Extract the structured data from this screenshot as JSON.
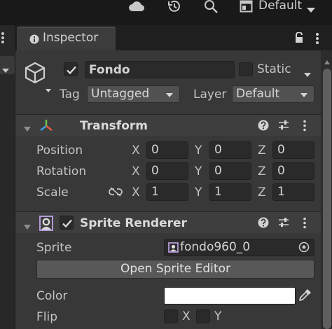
{
  "toolbar": {
    "icons": [
      "cloud-icon",
      "history-icon",
      "search-icon",
      "layout-icon"
    ],
    "layout_label": "Default"
  },
  "tab": {
    "title": "Inspector"
  },
  "object": {
    "active": true,
    "name": "Fondo",
    "static_label": "Static",
    "static_checked": false,
    "tag_label": "Tag",
    "tag_value": "Untagged",
    "layer_label": "Layer",
    "layer_value": "Default"
  },
  "transform": {
    "title": "Transform",
    "rows": [
      {
        "label": "Position",
        "x": "0",
        "y": "0",
        "z": "0"
      },
      {
        "label": "Rotation",
        "x": "0",
        "y": "0",
        "z": "0"
      },
      {
        "label": "Scale",
        "x": "1",
        "y": "1",
        "z": "1"
      }
    ],
    "axes": {
      "x": "X",
      "y": "Y",
      "z": "Z"
    }
  },
  "sprite_renderer": {
    "title": "Sprite Renderer",
    "enabled": true,
    "sprite_label": "Sprite",
    "sprite_value": "fondo960_0",
    "open_editor_label": "Open Sprite Editor",
    "color_label": "Color",
    "color_value": "#ffffff",
    "flip_label": "Flip",
    "flip_x_label": "X",
    "flip_y_label": "Y",
    "flip_x": false,
    "flip_y": false
  },
  "colors": {
    "panel_bg": "#383838",
    "header_bg": "#3e3e3e",
    "field_bg": "#2a2a2a",
    "button_bg": "#585858"
  }
}
